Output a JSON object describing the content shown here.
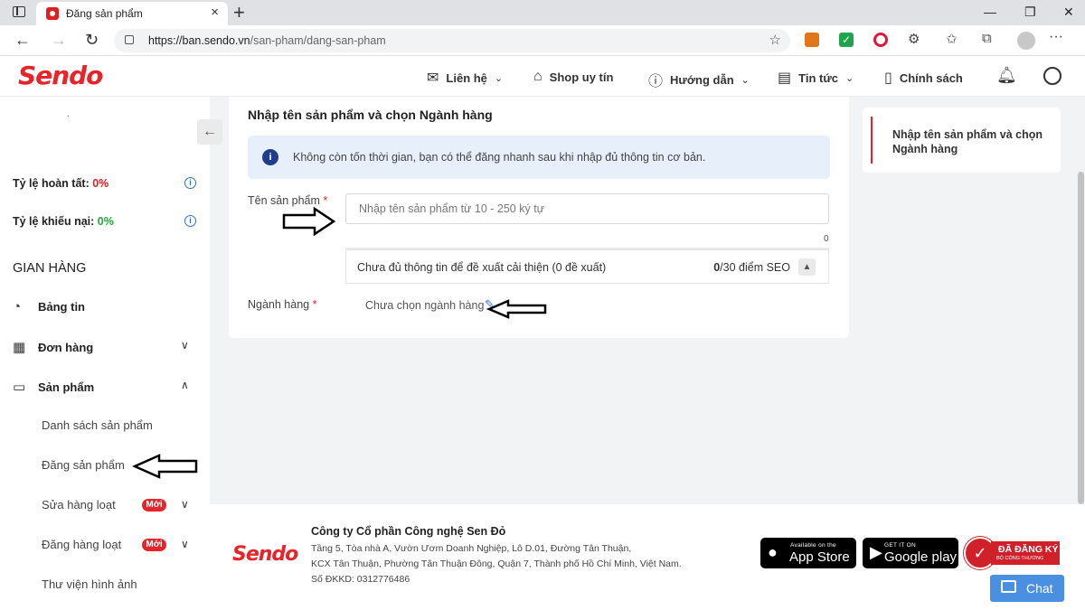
{
  "browser": {
    "tab_title": "Đăng sản phẩm",
    "url_host": "https://ban.sendo.vn",
    "url_path": "/san-pham/dang-san-pham"
  },
  "header": {
    "logo": "Sendo",
    "nav": [
      {
        "label": "Liên hệ",
        "icon": "mail-icon"
      },
      {
        "label": "Shop uy tín",
        "icon": "shop-icon"
      },
      {
        "label": "Hướng dẫn",
        "icon": "help-icon"
      },
      {
        "label": "Tin tức",
        "icon": "news-icon"
      },
      {
        "label": "Chính sách",
        "icon": "book-icon"
      }
    ]
  },
  "sidebar": {
    "stats": [
      {
        "label": "Tỷ lệ hoàn tất:",
        "value": "0%"
      },
      {
        "label": "Tỷ lệ khiếu nại:",
        "value": "0%"
      }
    ],
    "section_title": "GIAN HÀNG",
    "menu": [
      {
        "label": "Bảng tin"
      },
      {
        "label": "Đơn hàng"
      },
      {
        "label": "Sản phẩm"
      }
    ],
    "submenu": [
      {
        "label": "Danh sách sản phẩm"
      },
      {
        "label": "Đăng sản phẩm"
      },
      {
        "label": "Sửa hàng loạt",
        "badge": "Mới"
      },
      {
        "label": "Đăng hàng loạt",
        "badge": "Mới"
      },
      {
        "label": "Thư viện hình ảnh"
      }
    ]
  },
  "form": {
    "title": "Nhập tên sản phẩm và chọn Ngành hàng",
    "alert": "Không còn tốn thời gian, bạn có thể đăng nhanh sau khi nhập đủ thông tin cơ bản.",
    "name_label": "Tên sản phẩm",
    "required_mark": "*",
    "name_placeholder": "Nhập tên sản phẩm từ 10 - 250 ký tự",
    "name_value": "",
    "char_count": "0",
    "seo_text": "Chưa đủ thông tin để đề xuất cải thiện (0 đề xuất)",
    "seo_score": "0",
    "seo_suffix": "/30 điểm SEO",
    "category_label": "Ngành hàng",
    "category_value": "Chưa chọn ngành hàng"
  },
  "steps": {
    "current": "Nhập tên sản phẩm và chọn Ngành hàng"
  },
  "footer": {
    "logo": "Sendo",
    "company": "Công ty Cổ phần Công nghệ Sen Đỏ",
    "address_lines": [
      "Tầng 5, Tòa nhà A, Vườn Ươm Doanh Nghiệp, Lô D.01, Đường Tân Thuận,",
      "KCX Tân Thuận, Phường Tân Thuận Đông, Quận 7, Thành phố Hồ Chí Minh, Việt Nam.",
      "Số ĐKKD: 0312776486"
    ],
    "appstore_small": "Available on the",
    "appstore_big": "App Store",
    "gplay_small": "GET IT ON",
    "gplay_big": "Google play",
    "seal_title": "ĐÃ ĐĂNG KÝ",
    "seal_sub": "BỘ CÔNG THƯƠNG",
    "chat_label": "Chat"
  },
  "colors": {
    "brand": "#e8232a",
    "info": "#2f6fd0",
    "alert_bg": "#e7effb",
    "success": "#22a53b"
  }
}
